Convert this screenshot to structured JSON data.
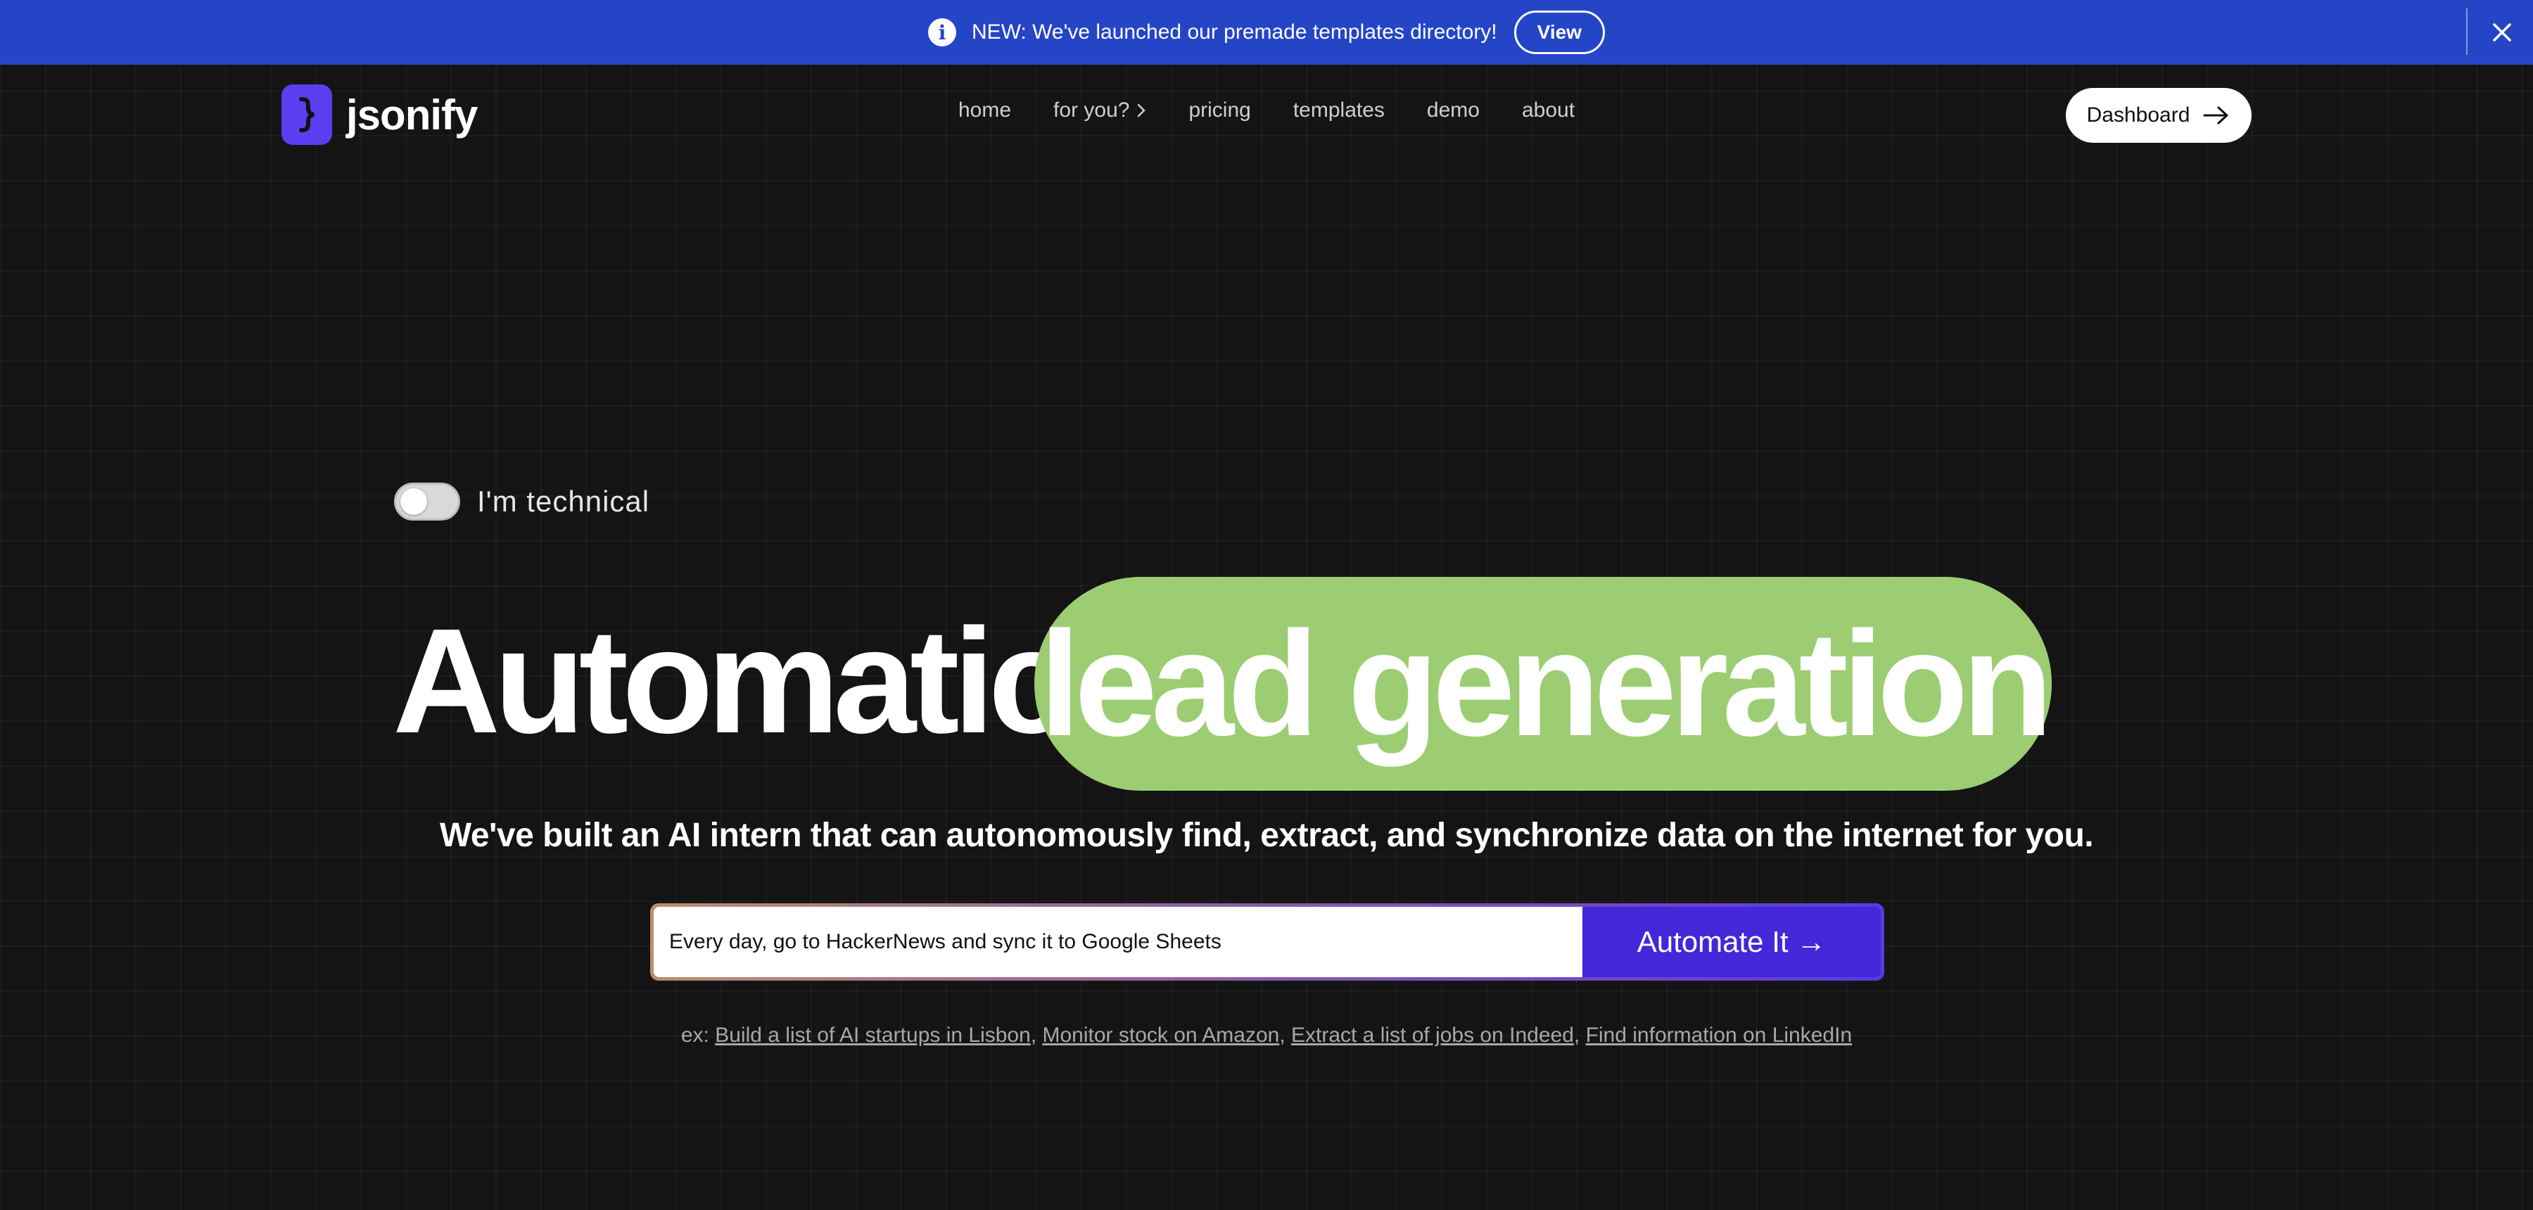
{
  "banner": {
    "info_icon": "info-icon",
    "text": "NEW: We've launched our premade templates directory!",
    "view_label": "View",
    "close_icon": "close-icon",
    "background": "#2545c7"
  },
  "nav": {
    "logo_text": "jsonify",
    "links": [
      {
        "label": "home"
      },
      {
        "label": "for you?"
      },
      {
        "label": "pricing"
      },
      {
        "label": "templates"
      },
      {
        "label": "demo"
      },
      {
        "label": "about"
      }
    ],
    "dashboard_label": "Dashboard"
  },
  "hero": {
    "toggle_label": "I'm technical",
    "toggle_on": false,
    "headline_word": "Automatic",
    "headline_highlight": "lead generation",
    "highlight_color": "#9ccd72",
    "subheadline": "We've built an AI intern that can autonomously find, extract, and synchronize data on the internet for you.",
    "prompt_value": "Every day, go to HackerNews and sync it to Google Sheets",
    "automate_label": "Automate It →",
    "accent_color": "#4427d9",
    "examples_prefix": "ex: ",
    "examples": [
      "Build a list of AI startups in Lisbon",
      "Monitor stock on Amazon",
      "Extract a list of jobs on Indeed",
      "Find information on LinkedIn"
    ]
  }
}
